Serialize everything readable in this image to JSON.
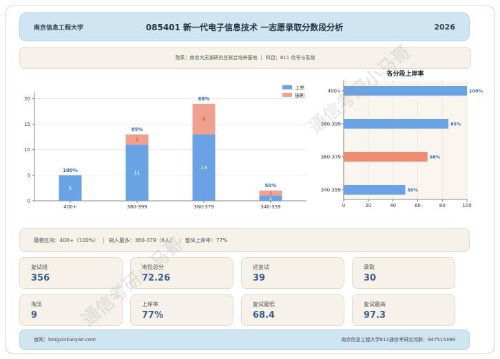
{
  "header": {
    "school": "南京信息工程大学",
    "title": "085401 新一代电子信息技术 一志愿录取分数段分析",
    "year": "2026"
  },
  "info": {
    "college": "院系：南信大无锡研究生联合培养基地",
    "subject": "科目：811 信号与系统",
    "sep": "|"
  },
  "chart_data": [
    {
      "type": "bar",
      "stacked": true,
      "categories": [
        "400+",
        "380-399",
        "360-379",
        "340-359"
      ],
      "series": [
        {
          "name": "上岸",
          "values": [
            5,
            11,
            13,
            1
          ],
          "color": "#6aa3e3"
        },
        {
          "name": "被刷",
          "values": [
            0,
            2,
            6,
            1
          ],
          "color": "#f0a08f"
        }
      ],
      "rate_labels": [
        "100%",
        "85%",
        "68%",
        "50%"
      ],
      "ylim": [
        0,
        21
      ],
      "yticks": [
        "0",
        "5",
        "10",
        "15",
        "20"
      ],
      "legend": "top-right",
      "grid": true
    },
    {
      "type": "bar",
      "orientation": "horizontal",
      "title": "各分段上岸率",
      "categories": [
        "400+",
        "380-399",
        "360-379",
        "340-359"
      ],
      "values": [
        100,
        85,
        68,
        50
      ],
      "value_labels": [
        "100%",
        "85%",
        "68%",
        "50%"
      ],
      "colors": [
        "#6aa3e3",
        "#6aa3e3",
        "#ee8c70",
        "#6aa3e3"
      ],
      "xlim": [
        0,
        100
      ],
      "xticks": [
        "0",
        "20",
        "40",
        "60",
        "80",
        "100"
      ],
      "grid": true
    }
  ],
  "summary": {
    "stable": "最稳区间：400+（100%）",
    "most": "刷人最多：360-379（6人）",
    "overall": "整体上岸率：77%",
    "sep": "|"
  },
  "stats": [
    {
      "label": "复试线",
      "value": "356"
    },
    {
      "label": "末位总分",
      "value": "72.26"
    },
    {
      "label": "进复试",
      "value": "39"
    },
    {
      "label": "录取",
      "value": "30"
    },
    {
      "label": "淘汰",
      "value": "9"
    },
    {
      "label": "上岸率",
      "value": "77%"
    },
    {
      "label": "复试最低",
      "value": "68.4"
    },
    {
      "label": "复试最高",
      "value": "97.3"
    }
  ],
  "footer": {
    "site": "官网：tongxinkaoyan.com",
    "group": "南京信息工程大学811通信考研交流群：947515369"
  },
  "watermark": "通信考研小马哥",
  "colors": {
    "header_bg": "#cfe6f2",
    "panel_bg": "#f6f1e9",
    "accent": "#3b5f8a"
  }
}
